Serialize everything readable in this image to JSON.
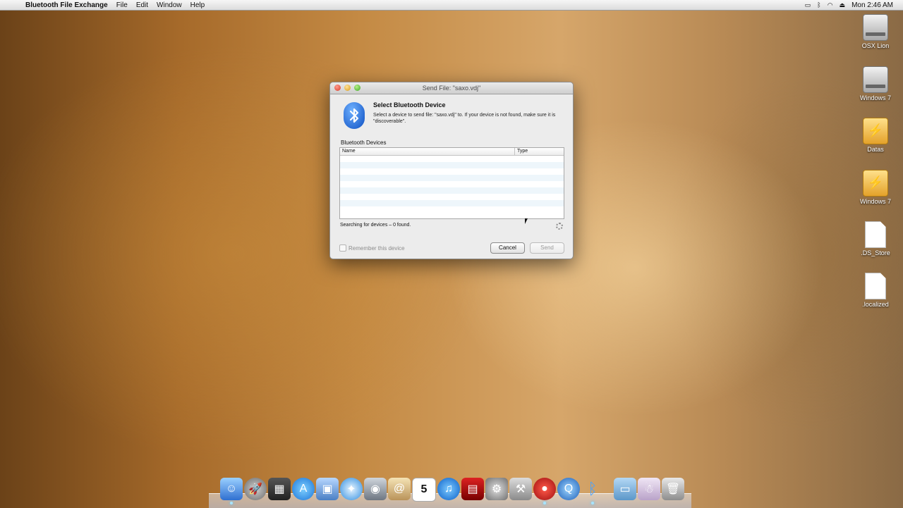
{
  "menubar": {
    "apple": "",
    "app_name": "Bluetooth File Exchange",
    "menus": [
      "File",
      "Edit",
      "Window",
      "Help"
    ],
    "clock": "Mon 2:46 AM"
  },
  "desktop_icons": [
    {
      "label": "OSX Lion",
      "kind": "hard-drive"
    },
    {
      "label": "Windows 7",
      "kind": "hard-drive"
    },
    {
      "label": "Datas",
      "kind": "usb-drive"
    },
    {
      "label": "Windows 7",
      "kind": "usb-drive"
    },
    {
      "label": ".DS_Store",
      "kind": "document"
    },
    {
      "label": ".localized",
      "kind": "document"
    }
  ],
  "dialog": {
    "title": "Send File: \"saxo.vdj\"",
    "heading": "Select Bluetooth Device",
    "description": "Select a device to send file: \"saxo.vdj\" to.  If your device is not found, make sure it is \"discoverable\".",
    "section_label": "Bluetooth Devices",
    "columns": [
      "Name",
      "Type"
    ],
    "rows": [],
    "status": "Searching for devices – 0 found.",
    "remember_label": "Remember this device",
    "remember_checked": false,
    "cancel_label": "Cancel",
    "send_label": "Send"
  },
  "dock": [
    "finder",
    "launchpad",
    "mission-control",
    "app-store",
    "preview",
    "safari",
    "facetime",
    "mail",
    "ical",
    "itunes",
    "photo-booth",
    "system-preferences",
    "automator",
    "vlc",
    "quicktime",
    "bluetooth",
    "folder",
    "downloads",
    "trash"
  ],
  "colors": {
    "accent": "#0d4fc2",
    "dialog_bg": "#ececec"
  }
}
